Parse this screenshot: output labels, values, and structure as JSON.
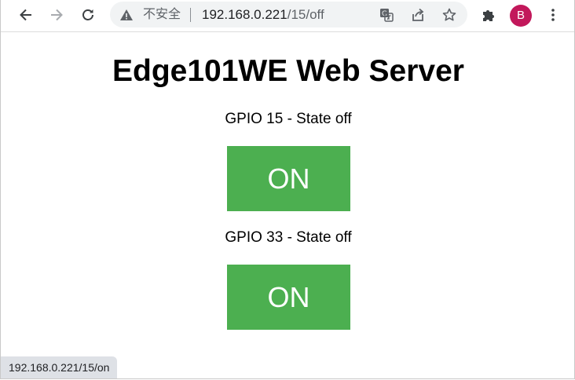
{
  "toolbar": {
    "back_icon": "arrow-left-icon",
    "forward_icon": "arrow-right-icon",
    "reload_icon": "reload-icon"
  },
  "omnibox": {
    "security_icon": "warning-triangle-icon",
    "security_text": "不安全",
    "url_host": "192.168.0.221",
    "url_path": "/15/off",
    "translate_icon": "translate-icon",
    "share_icon": "share-icon",
    "bookmark_icon": "star-icon"
  },
  "extensions_icon": "puzzle-icon",
  "profile": {
    "initial": "B",
    "color": "#c2185b"
  },
  "menu_icon": "kebab-menu-icon",
  "page": {
    "title": "Edge101WE Web Server",
    "gpios": [
      {
        "label": "GPIO 15 - State off",
        "button_label": "ON"
      },
      {
        "label": "GPIO 33 - State off",
        "button_label": "ON"
      }
    ],
    "button_color": "#4caf50"
  },
  "status_bar": {
    "link_url": "192.168.0.221/15/on"
  }
}
